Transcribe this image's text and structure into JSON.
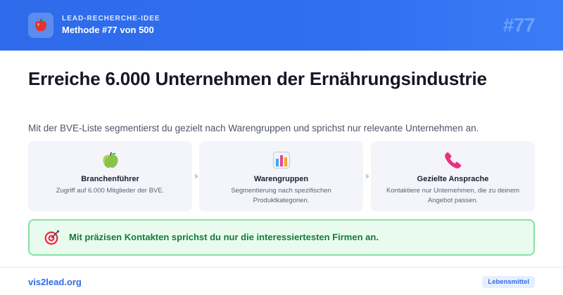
{
  "header": {
    "kicker": "LEAD-RECHERCHE-IDEE",
    "method": "Methode #77 von 500",
    "number": "#77",
    "logo_icon": "apple-icon"
  },
  "main": {
    "title": "Erreiche 6.000 Unternehmen der Ernährungsindustrie",
    "subtitle": "Mit der BVE-Liste segmentierst du gezielt nach Warengruppen und sprichst nur relevante Unternehmen an."
  },
  "cards": [
    {
      "icon": "green-apple-icon",
      "title": "Branchenführer",
      "desc": "Zugriff auf 6.000 Mitglieder der BVE."
    },
    {
      "icon": "bar-chart-icon",
      "title": "Warengruppen",
      "desc": "Segmentierung nach spezifischen Produktkategorien."
    },
    {
      "icon": "telephone-icon",
      "title": "Gezielte Ansprache",
      "desc": "Kontaktiere nur Unternehmen, die zu deinem Angebot passen."
    }
  ],
  "highlight": {
    "icon": "target-icon",
    "text": "Mit präzisen Kontakten sprichst du nur die interessiertesten Firmen an."
  },
  "footer": {
    "link": "vis2lead.org",
    "badge": "Lebensmittel"
  },
  "colors": {
    "header_blue": "#2f6bea",
    "highlight_green": "#157a3c",
    "link_blue": "#2f6be8"
  }
}
